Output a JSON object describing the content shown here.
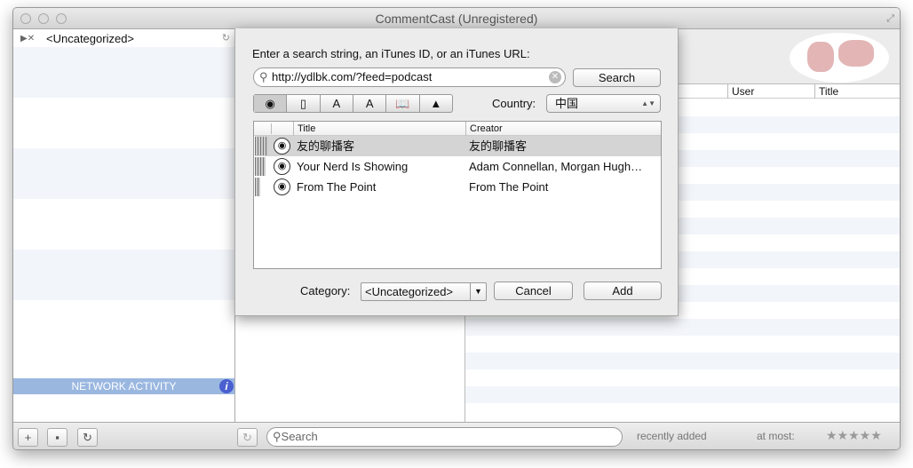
{
  "window": {
    "title": "CommentCast (Unregistered)"
  },
  "sidebar": {
    "items": [
      {
        "label": "<Uncategorized>"
      }
    ],
    "network_activity": "NETWORK ACTIVITY"
  },
  "right": {
    "columns": [
      "User",
      "Title"
    ]
  },
  "bottom": {
    "search_placeholder": "Search",
    "recently_added": "recently added",
    "at_most": "at most:",
    "stars": "★★★★★",
    "rating": 0
  },
  "sheet": {
    "prompt": "Enter a search string, an iTunes ID, or an iTunes URL:",
    "query": "http://ydlbk.com/?feed=podcast",
    "search_label": "Search",
    "media_types": [
      "podcast-icon",
      "iphone-app-icon",
      "ipad-app-icon",
      "mac-app-icon",
      "book-icon",
      "itunes-u-icon"
    ],
    "country_label": "Country:",
    "country_value": "中国",
    "columns": [
      "Title",
      "Creator"
    ],
    "results": [
      {
        "title": "友的聊播客",
        "creator": "友的聊播客",
        "popularity": 5
      },
      {
        "title": "Your Nerd Is Showing",
        "creator": "Adam Connellan, Morgan Hugh…",
        "popularity": 4
      },
      {
        "title": "From The Point",
        "creator": "From The Point",
        "popularity": 2
      }
    ],
    "category_label": "Category:",
    "category_value": "<Uncategorized>",
    "cancel_label": "Cancel",
    "add_label": "Add"
  }
}
